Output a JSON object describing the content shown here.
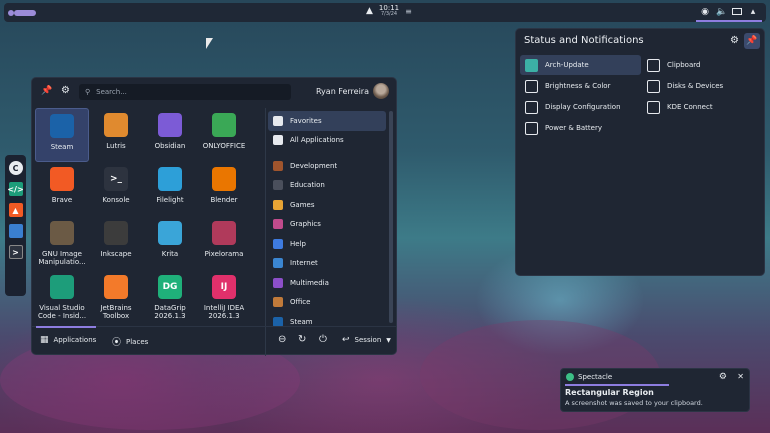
{
  "panel": {
    "time": "10:11",
    "date": "7/3/24"
  },
  "menu": {
    "search_placeholder": "Search...",
    "user_name": "Ryan Ferreira",
    "apps": [
      {
        "label": "Steam",
        "icon": "steam-icon",
        "color": "#1b62a8"
      },
      {
        "label": "Lutris",
        "icon": "lutris-icon",
        "color": "#e08a2f"
      },
      {
        "label": "Obsidian",
        "icon": "obsidian-icon",
        "color": "#7c5bd6"
      },
      {
        "label": "ONLYOFFICE",
        "icon": "onlyoffice-icon",
        "color": "#3aa856"
      },
      {
        "label": "Brave",
        "icon": "brave-icon",
        "color": "#f25a24"
      },
      {
        "label": "Konsole",
        "icon": "konsole-icon",
        "color": "#2d333f"
      },
      {
        "label": "Filelight",
        "icon": "filelight-icon",
        "color": "#2d9fd8"
      },
      {
        "label": "Blender",
        "icon": "blender-icon",
        "color": "#ea7600"
      },
      {
        "label": "GNU Image Manipulatio...",
        "icon": "gimp-icon",
        "color": "#6b5a45"
      },
      {
        "label": "Inkscape",
        "icon": "inkscape-icon",
        "color": "#3c3c3c"
      },
      {
        "label": "Krita",
        "icon": "krita-icon",
        "color": "#3aa5d8"
      },
      {
        "label": "Pixelorama",
        "icon": "pixelorama-icon",
        "color": "#b03a5b"
      },
      {
        "label": "Visual Studio Code - Insid...",
        "icon": "vscode-insiders-icon",
        "color": "#1d9d7a"
      },
      {
        "label": "JetBrains Toolbox",
        "icon": "jetbrains-toolbox-icon",
        "color": "#f37a2a"
      },
      {
        "label": "DataGrip 2026.1.3",
        "icon": "datagrip-icon",
        "color": "#1fb07a"
      },
      {
        "label": "IntelliJ IDEA 2026.1.3",
        "icon": "intellij-icon",
        "color": "#e0306b"
      }
    ],
    "icon_text": {
      "konsole": ">_",
      "datagrip": "DG",
      "intellij": "IJ"
    },
    "categories": [
      {
        "label": "Favorites",
        "icon": "bookmark-icon",
        "color": "#e6e9ee"
      },
      {
        "label": "All Applications",
        "icon": "grid-icon",
        "color": "#e6e9ee"
      },
      {
        "label": "Development",
        "icon": "development-icon",
        "color": "#a0552d"
      },
      {
        "label": "Education",
        "icon": "education-icon",
        "color": "#4a4f5c"
      },
      {
        "label": "Games",
        "icon": "games-icon",
        "color": "#e8a435"
      },
      {
        "label": "Graphics",
        "icon": "graphics-icon",
        "color": "#c14b8c"
      },
      {
        "label": "Help",
        "icon": "help-icon",
        "color": "#3e7be0"
      },
      {
        "label": "Internet",
        "icon": "internet-icon",
        "color": "#3b86d1"
      },
      {
        "label": "Multimedia",
        "icon": "multimedia-icon",
        "color": "#8c4fc9"
      },
      {
        "label": "Office",
        "icon": "office-icon",
        "color": "#c07a3a"
      },
      {
        "label": "Steam",
        "icon": "steam-icon",
        "color": "#1b62a8"
      }
    ],
    "footer": {
      "applications": "Applications",
      "places": "Places",
      "session": "Session"
    }
  },
  "status": {
    "title": "Status and Notifications",
    "items": [
      {
        "label": "Arch-Update",
        "icon": "arch-update-icon"
      },
      {
        "label": "Clipboard",
        "icon": "clipboard-icon"
      },
      {
        "label": "Brightness & Color",
        "icon": "brightness-icon"
      },
      {
        "label": "Disks & Devices",
        "icon": "usb-icon"
      },
      {
        "label": "Display Configuration",
        "icon": "display-icon"
      },
      {
        "label": "KDE Connect",
        "icon": "phone-icon"
      },
      {
        "label": "Power & Battery",
        "icon": "battery-icon"
      }
    ]
  },
  "notification": {
    "app": "Spectacle",
    "title": "Rectangular Region",
    "body": "A screenshot was saved to your clipboard."
  },
  "colors": {
    "accent": "#8d7de0",
    "panel_bg": "#1f2633"
  }
}
